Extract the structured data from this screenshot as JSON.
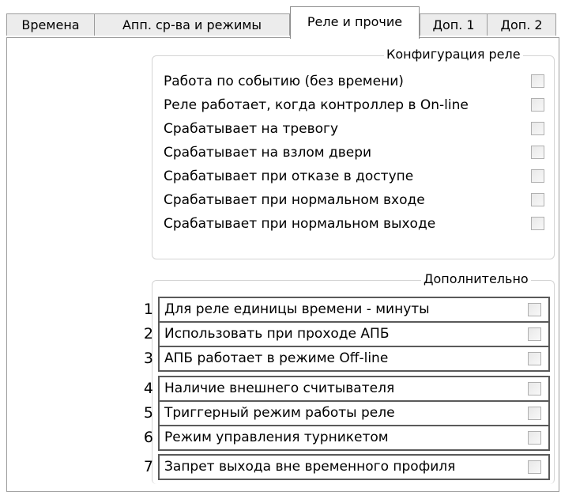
{
  "tabs": [
    {
      "label": "Времена"
    },
    {
      "label": "Апп. ср-ва и режимы"
    },
    {
      "label": "Реле и прочие"
    },
    {
      "label": "Доп. 1"
    },
    {
      "label": "Доп. 2"
    }
  ],
  "active_tab": "Реле и прочие",
  "relay_config": {
    "title": "Конфигурация реле",
    "items": [
      {
        "label": "Работа по событию (без времени)",
        "checked": false
      },
      {
        "label": "Реле работает, когда контроллер в On-line",
        "checked": false
      },
      {
        "label": "Срабатывает на тревогу",
        "checked": false
      },
      {
        "label": "Срабатывает на взлом двери",
        "checked": false
      },
      {
        "label": "Срабатывает при отказе в доступе",
        "checked": false
      },
      {
        "label": "Срабатывает при нормальном входе",
        "checked": false
      },
      {
        "label": "Срабатывает при нормальном выходе",
        "checked": false
      }
    ]
  },
  "additional": {
    "title": "Дополнительно",
    "items": [
      {
        "num": "1",
        "label": "Для реле единицы времени - минуты",
        "checked": false
      },
      {
        "num": "2",
        "label": "Использовать при проходе АПБ",
        "checked": false
      },
      {
        "num": "3",
        "label": "АПБ работает в режиме Off-line",
        "checked": false
      },
      {
        "num": "4",
        "label": "Наличие внешнего считывателя",
        "checked": false
      },
      {
        "num": "5",
        "label": "Триггерный режим работы реле",
        "checked": false
      },
      {
        "num": "6",
        "label": "Режим управления турникетом",
        "checked": false
      },
      {
        "num": "7",
        "label": "Запрет выхода вне временного профиля",
        "checked": false
      }
    ]
  }
}
